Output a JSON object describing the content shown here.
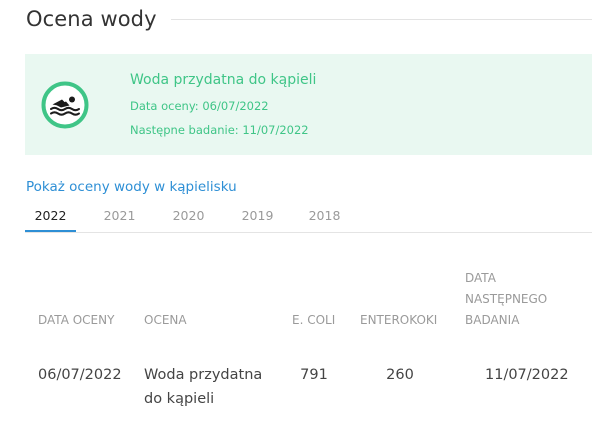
{
  "section": {
    "title": "Ocena wody"
  },
  "status": {
    "icon": "swimmer-icon",
    "color": "#3fc587",
    "background": "#e9f8f1",
    "title": "Woda przydatna do kąpieli",
    "assessment_date_text": "Data oceny: 06/07/2022",
    "next_test_text": "Następne badanie: 11/07/2022"
  },
  "link": {
    "label": "Pokaż oceny wody w kąpielisku"
  },
  "tabs": [
    {
      "label": "2022",
      "active": true
    },
    {
      "label": "2021",
      "active": false
    },
    {
      "label": "2020",
      "active": false
    },
    {
      "label": "2019",
      "active": false
    },
    {
      "label": "2018",
      "active": false
    }
  ],
  "table": {
    "headers": {
      "date": "DATA OCENY",
      "rating": "OCENA",
      "ecoli": "E. COLI",
      "enterococci": "ENTEROKOKI",
      "next_line1": "DATA",
      "next_line2": "NASTĘPNEGO",
      "next_line3": "BADANIA"
    },
    "rows": [
      {
        "date": "06/07/2022",
        "rating_line1": "Woda przydatna",
        "rating_line2": "do kąpieli",
        "ecoli": "791",
        "enterococci": "260",
        "next": "11/07/2022"
      }
    ]
  },
  "colors": {
    "accent": "#2e8fd5",
    "status_green": "#3fc587"
  }
}
